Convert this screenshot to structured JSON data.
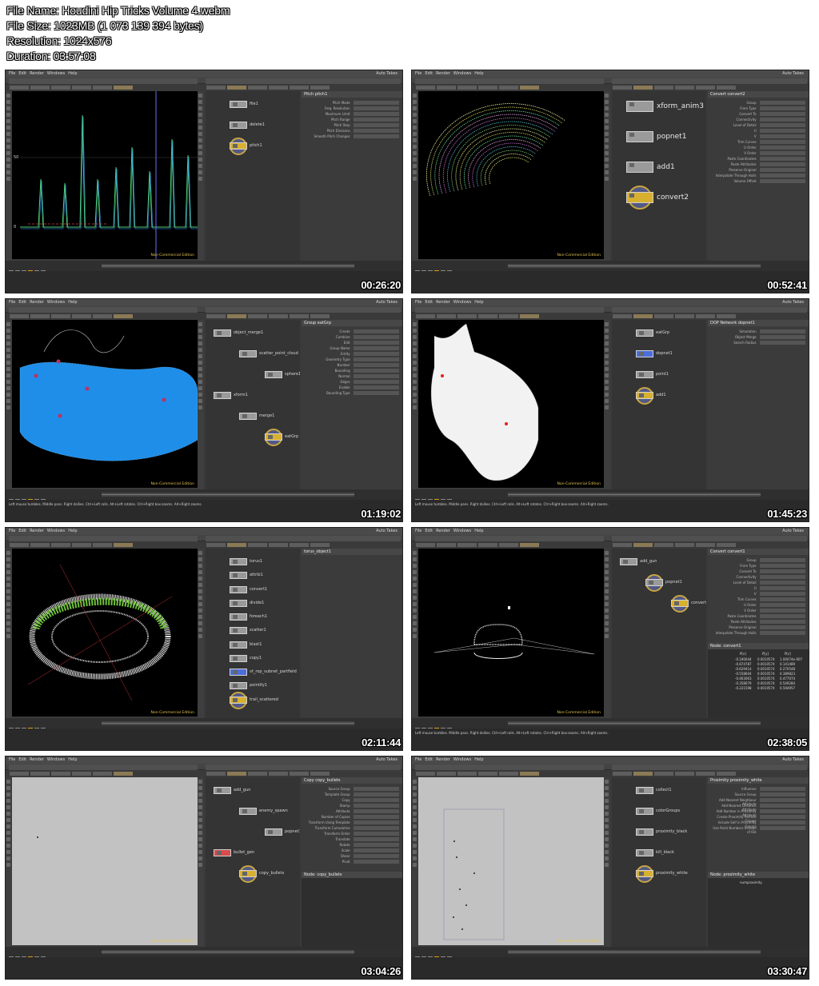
{
  "header": {
    "file_name": "File Name: Houdini Hip Tricks Volume 4.webm",
    "file_size": "File Size: 1023MB (1 073 139 394 bytes)",
    "resolution": "Resolution: 1024x576",
    "duration": "Duration: 03:57:08"
  },
  "common": {
    "menu": [
      "File",
      "Edit",
      "Render",
      "Windows",
      "Help"
    ],
    "auto_takes": "Auto Takes",
    "main": "Main",
    "non_commercial": "Non-Commercial Edition",
    "view_label": "View",
    "status_hint": "Left mouse tumbles. Middle pans. Right dollies. Ctrl+Left rolls. Alt+Left rotates. Ctrl+Right box-zooms. Alt+Right zooms."
  },
  "frames": [
    {
      "timestamp": "00:26:20",
      "param_title": "Pitch  pitch1",
      "param_rows": [
        "Pitch Mode",
        "Freq. Resolution",
        "Maximum Limit",
        "Pitch Range",
        "Pitch Step",
        "Pitch Divisions",
        "Smooth Pitch Changes"
      ],
      "nodes": [
        "file1",
        "delete1",
        "pitch1"
      ],
      "axis_labels": [
        "50",
        "0"
      ]
    },
    {
      "timestamp": "00:52:41",
      "param_title": "Convert  convert2",
      "param_rows": [
        "Group",
        "From Type",
        "Convert To",
        "Connectivity",
        "Level of Detail",
        "U",
        "V",
        "Trim Curves",
        "U Order",
        "V Order",
        "Paste Coordinates",
        "Paste Attributes",
        "Preserve Original",
        "Interpolate Through Hulls",
        "Volume Offset"
      ],
      "nodes": [
        "xform_anim3",
        "popnet1",
        "add1",
        "convert2"
      ]
    },
    {
      "timestamp": "01:19:02",
      "param_title": "Group  eatGrp",
      "param_rows": [
        "Create",
        "Combine",
        "Edit",
        "Group Name",
        "Entity",
        "Geometry Type",
        "Number",
        "Bounding",
        "Normal",
        "Edges",
        "Enable",
        "Bounding Type"
      ],
      "nodes": [
        "object_merge1",
        "scatter_point_cloud",
        "sphere1",
        "xform1",
        "merge1",
        "eatGrp"
      ]
    },
    {
      "timestamp": "01:45:23",
      "param_title": "DOP Network  dopnet1",
      "param_rows": [
        "Simulation",
        "Object Merge",
        "Search Radius"
      ],
      "nodes": [
        "eatGrp",
        "dopnet1",
        "point1",
        "add1"
      ]
    },
    {
      "timestamp": "02:11:44",
      "param_title": "torus_object1",
      "param_rows": [],
      "nodes": [
        "torus1",
        "attrib1",
        "convert1",
        "divide1",
        "foreach1",
        "scatter1",
        "blast1",
        "copy1",
        "vt_rop_subnet_partfield",
        "pointify1",
        "trail_scattered"
      ]
    },
    {
      "timestamp": "02:38:05",
      "param_title": "Convert  convert1",
      "param_rows": [
        "Group",
        "From Type",
        "Convert To",
        "Connectivity",
        "Level of Detail",
        "U",
        "V",
        "Trim Curves",
        "U Order",
        "V Order",
        "Paste Coordinates",
        "Paste Attributes",
        "Preserve Original",
        "Interpolate Through Hulls"
      ],
      "nodes": [
        "add_gun",
        "popnet1",
        "convert1"
      ],
      "spreadsheet_title": "Node: convert1",
      "spreadsheet_columns": [
        "P[x]",
        "P[y]",
        "P[z]"
      ],
      "spreadsheet_rows": [
        [
          "-0.190044",
          "0.0010574",
          "1.00074e-007"
        ],
        [
          "-0.874787",
          "0.0010574",
          "0.141489"
        ],
        [
          "-0.629414",
          "0.0010574",
          "0.270548"
        ],
        [
          "-0.558604",
          "0.0010574",
          "0.389823"
        ],
        [
          "-0.463063",
          "0.0010574",
          "0.477074"
        ],
        [
          "-0.358079",
          "0.0010574",
          "0.549284"
        ],
        [
          "-0.221598",
          "0.0010574",
          "0.594957"
        ]
      ]
    },
    {
      "timestamp": "03:04:26",
      "param_title": "Copy  copy_bullets",
      "param_rows": [
        "Source Group",
        "Template Group",
        "Copy",
        "Stamp",
        "Attribute",
        "Number of Copies",
        "Transform Using Template",
        "Transform Cumulative",
        "Transform Order",
        "Translate",
        "Rotate",
        "Scale",
        "Shear",
        "Pivot",
        "Uniform Scale",
        "Preserve Normal Length",
        "Create Output Groups",
        "Copy Groups"
      ],
      "nodes": [
        "add_gun",
        "enemy_spawn",
        "popnet1",
        "bullet_gen",
        "copy_bullets"
      ],
      "spreadsheet_title": "Node: copy_bullets"
    },
    {
      "timestamp": "03:30:47",
      "param_title": "Proximity  proximity_white",
      "param_rows": [
        "Influence",
        "Source Group",
        "Add Nearest Neighbour Attribute",
        "Add Nearest Distance Attribute",
        "Add Number in Proximity Attribute",
        "Create Proximity Particle Groups",
        "Include Self in Proximity Groups",
        "Use Point Numbers Instead of IDs"
      ],
      "nodes": [
        "collect1",
        "colorGroups",
        "proximity_black",
        "kill_black",
        "proximity_white"
      ],
      "spreadsheet_title": "Node: proximity_white",
      "spreadsheet_columns": [
        "numproximity"
      ]
    }
  ]
}
